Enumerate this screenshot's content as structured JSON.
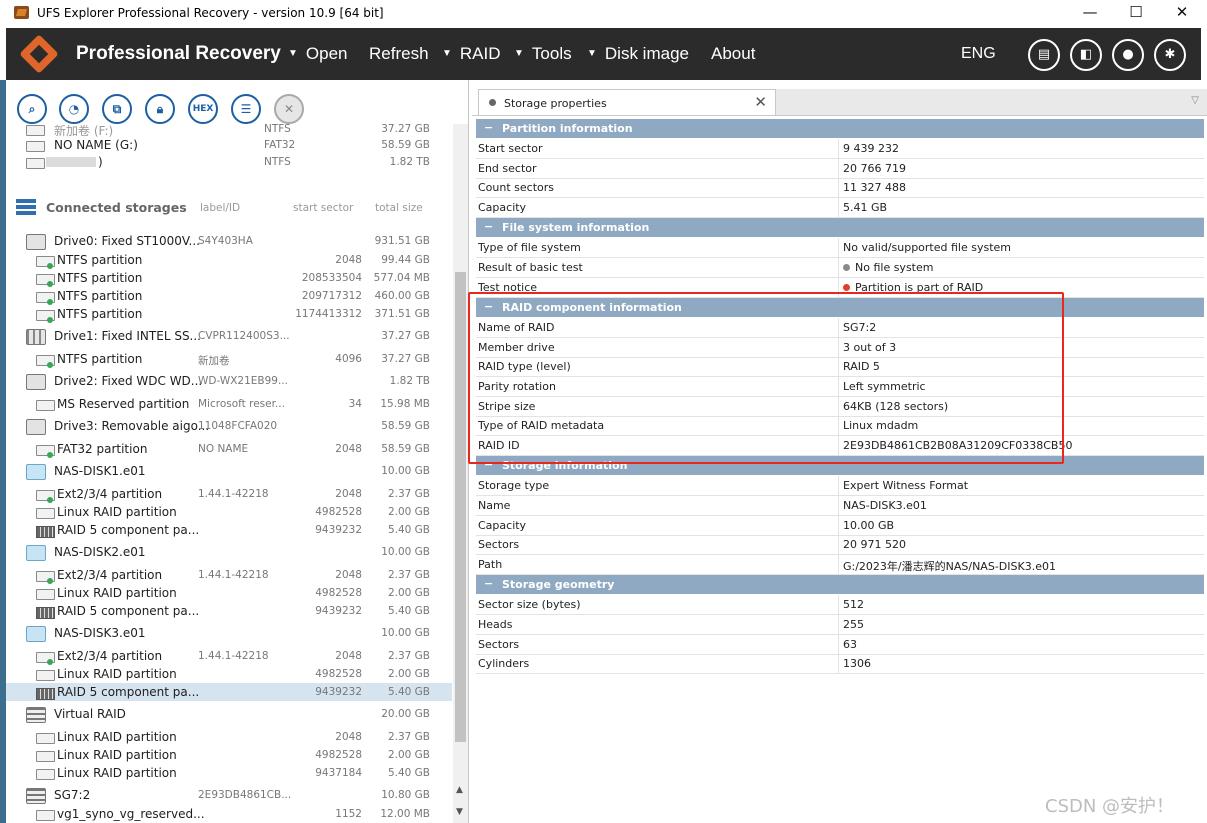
{
  "window": {
    "title": "UFS Explorer Professional Recovery - version 10.9 [64 bit]",
    "minimize": "—",
    "maximize": "☐",
    "close": "✕"
  },
  "header": {
    "brand": "Professional Recovery",
    "menu": [
      "Open",
      "Refresh",
      "RAID",
      "Tools",
      "Disk image",
      "About"
    ],
    "menu_carets": [
      "▼",
      "",
      "▼",
      "▼",
      "▼",
      ""
    ],
    "language": "ENG",
    "icons": [
      "log-icon",
      "panel-icon",
      "user-icon",
      "settings-icon"
    ]
  },
  "toolbar": {
    "hex_label": "HEX",
    "icons": [
      "search-icon",
      "scan-icon",
      "copy-icon",
      "lock-icon",
      "hex-icon",
      "list-icon",
      "close-icon"
    ]
  },
  "tree": {
    "top_rows": [
      {
        "name": "新加卷 (F:)",
        "fs": "NTFS",
        "size": "37.27 GB"
      },
      {
        "name": "NO NAME (G:)",
        "fs": "FAT32",
        "size": "58.59 GB"
      },
      {
        "name": ")",
        "fs": "NTFS",
        "size": "1.82 TB"
      }
    ],
    "connected_header": {
      "title": "Connected storages",
      "col_label": "label/ID",
      "col_start": "start sector",
      "col_total": "total size"
    },
    "rows": [
      {
        "level": 0,
        "icon": "disk",
        "name": "Drive0: Fixed ST1000V...",
        "label": "S4Y403HA",
        "start": "",
        "size": "931.51 GB"
      },
      {
        "level": 1,
        "icon": "part",
        "name": "NTFS partition",
        "label": "",
        "start": "2048",
        "size": "99.44 GB"
      },
      {
        "level": 1,
        "icon": "part",
        "name": "NTFS partition",
        "label": "",
        "start": "208533504",
        "size": "577.04 MB"
      },
      {
        "level": 1,
        "icon": "part",
        "name": "NTFS partition",
        "label": "",
        "start": "209717312",
        "size": "460.00 GB"
      },
      {
        "level": 1,
        "icon": "part",
        "name": "NTFS partition",
        "label": "",
        "start": "1174413312",
        "size": "371.51 GB"
      },
      {
        "level": 0,
        "icon": "ssd",
        "name": "Drive1: Fixed INTEL SS...",
        "label": "CVPR112400S3...",
        "start": "",
        "size": "37.27 GB"
      },
      {
        "level": 1,
        "icon": "part",
        "name": "NTFS partition",
        "label": "新加卷",
        "start": "4096",
        "size": "37.27 GB"
      },
      {
        "level": 0,
        "icon": "disk",
        "name": "Drive2: Fixed WDC WD...",
        "label": "WD-WX21EB99...",
        "start": "",
        "size": "1.82 TB"
      },
      {
        "level": 1,
        "icon": "partplain",
        "name": "MS Reserved partition",
        "label": "Microsoft reser...",
        "start": "34",
        "size": "15.98 MB"
      },
      {
        "level": 0,
        "icon": "disk",
        "name": "Drive3: Removable aigo...",
        "label": "11048FCFA020",
        "start": "",
        "size": "58.59 GB"
      },
      {
        "level": 1,
        "icon": "part",
        "name": "FAT32 partition",
        "label": "NO NAME",
        "start": "2048",
        "size": "58.59 GB"
      },
      {
        "level": 0,
        "icon": "image",
        "name": "NAS-DISK1.e01",
        "label": "",
        "start": "",
        "size": "10.00 GB"
      },
      {
        "level": 1,
        "icon": "part",
        "name": "Ext2/3/4 partition",
        "label": "1.44.1-42218",
        "start": "2048",
        "size": "2.37 GB"
      },
      {
        "level": 1,
        "icon": "partplain",
        "name": "Linux RAID partition",
        "label": "",
        "start": "4982528",
        "size": "2.00 GB"
      },
      {
        "level": 1,
        "icon": "raid",
        "name": "RAID 5 component pa...",
        "label": "",
        "start": "9439232",
        "size": "5.40 GB"
      },
      {
        "level": 0,
        "icon": "image",
        "name": "NAS-DISK2.e01",
        "label": "",
        "start": "",
        "size": "10.00 GB"
      },
      {
        "level": 1,
        "icon": "part",
        "name": "Ext2/3/4 partition",
        "label": "1.44.1-42218",
        "start": "2048",
        "size": "2.37 GB"
      },
      {
        "level": 1,
        "icon": "partplain",
        "name": "Linux RAID partition",
        "label": "",
        "start": "4982528",
        "size": "2.00 GB"
      },
      {
        "level": 1,
        "icon": "raid",
        "name": "RAID 5 component pa...",
        "label": "",
        "start": "9439232",
        "size": "5.40 GB"
      },
      {
        "level": 0,
        "icon": "image",
        "name": "NAS-DISK3.e01",
        "label": "",
        "start": "",
        "size": "10.00 GB"
      },
      {
        "level": 1,
        "icon": "part",
        "name": "Ext2/3/4 partition",
        "label": "1.44.1-42218",
        "start": "2048",
        "size": "2.37 GB"
      },
      {
        "level": 1,
        "icon": "partplain",
        "name": "Linux RAID partition",
        "label": "",
        "start": "4982528",
        "size": "2.00 GB"
      },
      {
        "level": 1,
        "icon": "raid",
        "name": "RAID 5 component pa...",
        "label": "",
        "start": "9439232",
        "size": "5.40 GB",
        "selected": true
      },
      {
        "level": 0,
        "icon": "vraid",
        "name": "Virtual RAID",
        "label": "",
        "start": "",
        "size": "20.00 GB"
      },
      {
        "level": 1,
        "icon": "partplain",
        "name": "Linux RAID partition",
        "label": "",
        "start": "2048",
        "size": "2.37 GB"
      },
      {
        "level": 1,
        "icon": "partplain",
        "name": "Linux RAID partition",
        "label": "",
        "start": "4982528",
        "size": "2.00 GB"
      },
      {
        "level": 1,
        "icon": "partplain",
        "name": "Linux RAID partition",
        "label": "",
        "start": "9437184",
        "size": "5.40 GB"
      },
      {
        "level": 0,
        "icon": "vraid",
        "name": "SG7:2",
        "label": "2E93DB4861CB...",
        "start": "",
        "size": "10.80 GB"
      },
      {
        "level": 1,
        "icon": "partplain",
        "name": "vg1_syno_vg_reserved...",
        "label": "",
        "start": "1152",
        "size": "12.00 MB"
      }
    ]
  },
  "properties": {
    "tab_title": "Storage properties",
    "tab_close": "✕",
    "sections": [
      {
        "title": "Partition information",
        "rows": [
          {
            "key": "Start sector",
            "value": "9 439 232"
          },
          {
            "key": "End sector",
            "value": "20 766 719"
          },
          {
            "key": "Count sectors",
            "value": "11 327 488"
          },
          {
            "key": "Capacity",
            "value": "5.41 GB"
          }
        ]
      },
      {
        "title": "File system information",
        "rows": [
          {
            "key": "Type of file system",
            "value": "No valid/supported file system"
          },
          {
            "key": "Result of basic test",
            "value": "No file system",
            "status": "#8a8a8a"
          },
          {
            "key": "Test notice",
            "value": "Partition is part of RAID",
            "status": "#e0402b"
          }
        ]
      },
      {
        "title": "RAID component information",
        "rows": [
          {
            "key": "Name of RAID",
            "value": "SG7:2"
          },
          {
            "key": "Member drive",
            "value": "3 out of 3"
          },
          {
            "key": "RAID type (level)",
            "value": "RAID 5"
          },
          {
            "key": "Parity rotation",
            "value": "Left symmetric"
          },
          {
            "key": "Stripe size",
            "value": "64KB (128 sectors)"
          },
          {
            "key": "Type of RAID metadata",
            "value": "Linux mdadm"
          },
          {
            "key": "RAID ID",
            "value": "2E93DB4861CB2B08A31209CF0338CB50"
          }
        ]
      },
      {
        "title": "Storage information",
        "rows": [
          {
            "key": "Storage type",
            "value": "Expert Witness Format"
          },
          {
            "key": "Name",
            "value": "NAS-DISK3.e01"
          },
          {
            "key": "Capacity",
            "value": "10.00 GB"
          },
          {
            "key": "Sectors",
            "value": "20 971 520"
          },
          {
            "key": "Path",
            "value": "G:/2023年/潘志辉的NAS/NAS-DISK3.e01"
          }
        ]
      },
      {
        "title": "Storage geometry",
        "rows": [
          {
            "key": "Sector size (bytes)",
            "value": "512"
          },
          {
            "key": "Heads",
            "value": "255"
          },
          {
            "key": "Sectors",
            "value": "63"
          },
          {
            "key": "Cylinders",
            "value": "1306"
          }
        ]
      }
    ]
  },
  "watermark": "CSDN @安护！",
  "colors": {
    "topbar": "#2b2b2b",
    "section_header": "#8fa9c2",
    "highlight_box": "#e8281f",
    "selected_row": "#d6e4f0"
  }
}
